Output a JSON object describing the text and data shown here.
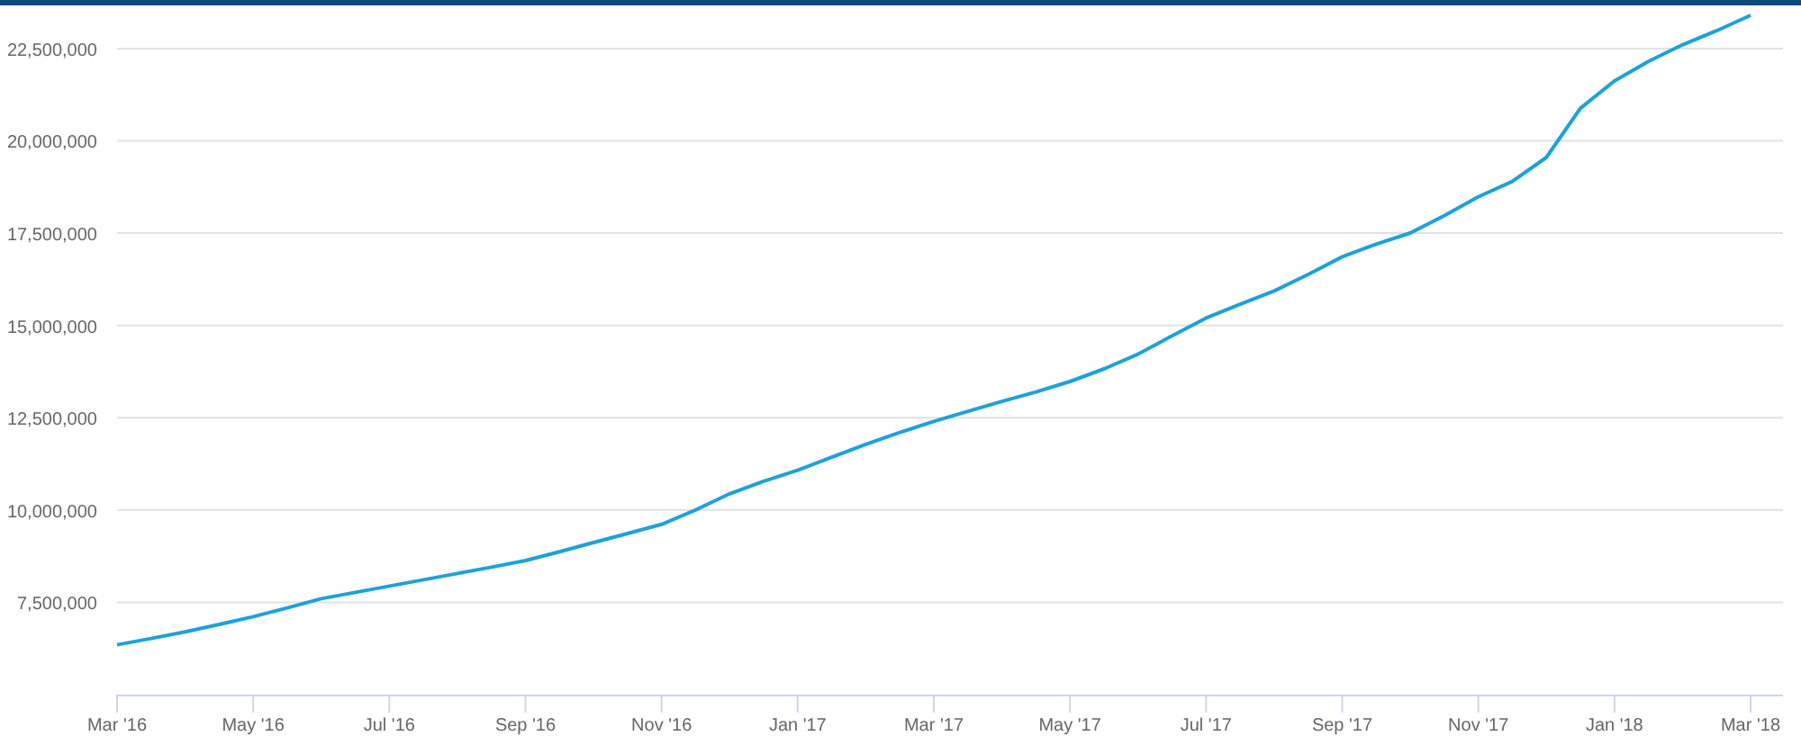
{
  "chart": {
    "chart_data": {
      "type": "line",
      "categories": [
        "Mar '16",
        null,
        null,
        null,
        "May '16",
        null,
        null,
        null,
        "Jul '16",
        null,
        null,
        null,
        "Sep '16",
        null,
        null,
        null,
        "Nov '16",
        null,
        null,
        null,
        "Jan '17",
        null,
        null,
        null,
        "Mar '17",
        null,
        null,
        null,
        "May '17",
        null,
        null,
        null,
        "Jul '17",
        null,
        null,
        null,
        "Sep '17",
        null,
        null,
        null,
        "Nov '17",
        null,
        null,
        null,
        "Jan '18",
        null,
        null,
        null,
        "Mar '18"
      ],
      "series": [
        {
          "color": "#1ea1d9",
          "values": [
            6350000,
            6520000,
            6700000,
            6900000,
            7110000,
            7350000,
            7600000,
            7770000,
            7940000,
            8110000,
            8280000,
            8450000,
            8630000,
            8870000,
            9120000,
            9360000,
            9610000,
            10000000,
            10440000,
            10780000,
            11080000,
            11430000,
            11780000,
            12100000,
            12400000,
            12670000,
            12940000,
            13200000,
            13480000,
            13820000,
            14220000,
            14720000,
            15200000,
            15570000,
            15930000,
            16380000,
            16860000,
            17200000,
            17500000,
            17970000,
            18480000,
            18900000,
            19550000,
            20880000,
            21620000,
            22150000,
            22600000,
            22980000,
            23400000
          ]
        }
      ],
      "ylim": [
        5000000,
        23740000
      ],
      "grid": true,
      "yticks": [
        {
          "value": 7500000,
          "label": "7,500,000"
        },
        {
          "value": 10000000,
          "label": "10,000,000"
        },
        {
          "value": 12500000,
          "label": "12,500,000"
        },
        {
          "value": 15000000,
          "label": "15,000,000"
        },
        {
          "value": 17500000,
          "label": "17,500,000"
        },
        {
          "value": 20000000,
          "label": "20,000,000"
        },
        {
          "value": 22500000,
          "label": "22,500,000"
        }
      ]
    }
  }
}
